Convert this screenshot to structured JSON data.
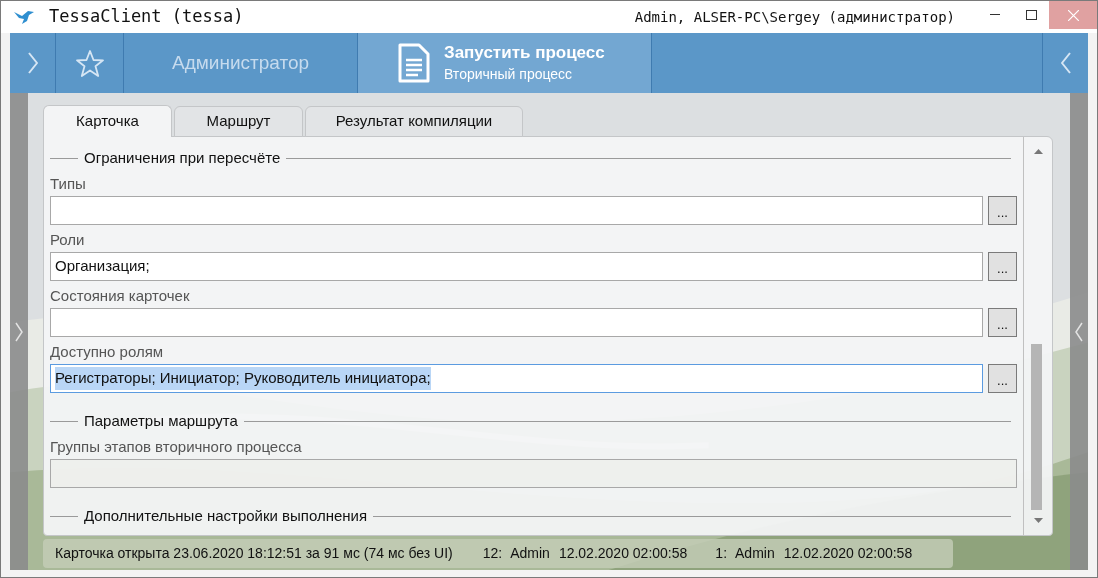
{
  "window": {
    "title": "TessaClient (tessa)",
    "user": "Admin, ALSER-PC\\Sergey (администратор)"
  },
  "nav": {
    "workspace": "Администратор",
    "tabs": [
      {
        "title": "Запустить процесс",
        "subtitle": "Вторичный процесс",
        "selected": true
      }
    ]
  },
  "tabs": [
    {
      "label": "Карточка",
      "selected": true
    },
    {
      "label": "Маршрут",
      "selected": false
    },
    {
      "label": "Результат компиляции",
      "selected": false
    }
  ],
  "form": [
    {
      "kind": "section",
      "title": "Ограничения при пересчёте"
    },
    {
      "kind": "field",
      "label": "Типы",
      "button": "...",
      "focused": false,
      "disabled": false
    },
    {
      "kind": "field",
      "label": "Роли",
      "value": "Организация;",
      "button": "...",
      "focused": false,
      "disabled": false
    },
    {
      "kind": "field",
      "label": "Состояния карточек",
      "button": "...",
      "focused": false,
      "disabled": false
    },
    {
      "kind": "field",
      "label": "Доступно ролям",
      "value": "Регистраторы; Инициатор; Руководитель инициатора;",
      "button": "...",
      "focused": true,
      "disabled": false,
      "text_selected": true
    },
    {
      "kind": "section",
      "title": "Параметры маршрута"
    },
    {
      "kind": "field",
      "label": "Группы этапов вторичного процесса",
      "focused": false,
      "disabled": true
    },
    {
      "kind": "section",
      "title": "Дополнительные настройки выполнения"
    }
  ],
  "status_bar": {
    "text": "Карточка открыта 23.06.2020 18:12:51 за 91 мс (74 мс без UI)",
    "versions": [
      {
        "number": "12:",
        "user": "Admin",
        "date": "12.02.2020 02:00:58"
      },
      {
        "number": "1:",
        "user": "Admin",
        "date": "12.02.2020 02:00:58"
      }
    ]
  }
}
